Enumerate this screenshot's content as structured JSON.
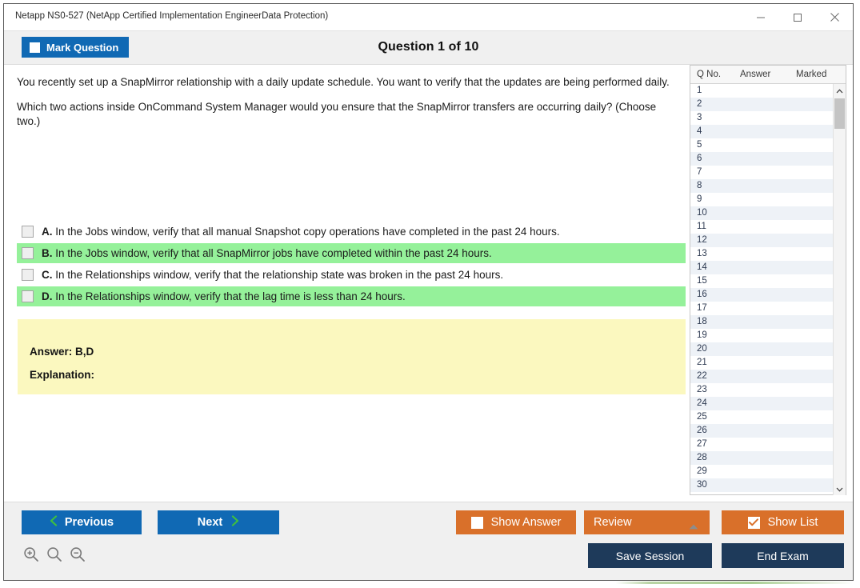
{
  "window": {
    "title": "Netapp NS0-527 (NetApp Certified Implementation EngineerData Protection)",
    "controls": {
      "minimize": "minimize-icon",
      "maximize": "maximize-icon",
      "close": "close-icon"
    }
  },
  "header": {
    "mark_question_label": "Mark Question",
    "question_counter": "Question 1 of 10"
  },
  "question": {
    "stem_paragraphs": [
      "You recently set up a SnapMirror relationship with a daily update schedule. You want to verify that the updates are being performed daily.",
      "Which two actions inside OnCommand System Manager would you ensure that the SnapMirror transfers are occurring daily? (Choose two.)"
    ],
    "options": [
      {
        "letter": "A.",
        "text": "In the Jobs window, verify that all manual Snapshot copy operations have completed in the past 24 hours.",
        "correct": false,
        "checked": false
      },
      {
        "letter": "B.",
        "text": "In the Jobs window, verify that all SnapMirror jobs have completed within the past 24 hours.",
        "correct": true,
        "checked": false
      },
      {
        "letter": "C.",
        "text": "In the Relationships window, verify that the relationship state was broken in the past 24 hours.",
        "correct": false,
        "checked": false
      },
      {
        "letter": "D.",
        "text": "In the Relationships window, verify that the lag time is less than 24 hours.",
        "correct": true,
        "checked": false
      }
    ],
    "answer_label": "Answer: B,D",
    "explanation_label": "Explanation:"
  },
  "list_panel": {
    "columns": [
      "Q No.",
      "Answer",
      "Marked"
    ],
    "rows": [
      {
        "no": "1",
        "answer": "",
        "marked": ""
      },
      {
        "no": "2",
        "answer": "",
        "marked": ""
      },
      {
        "no": "3",
        "answer": "",
        "marked": ""
      },
      {
        "no": "4",
        "answer": "",
        "marked": ""
      },
      {
        "no": "5",
        "answer": "",
        "marked": ""
      },
      {
        "no": "6",
        "answer": "",
        "marked": ""
      },
      {
        "no": "7",
        "answer": "",
        "marked": ""
      },
      {
        "no": "8",
        "answer": "",
        "marked": ""
      },
      {
        "no": "9",
        "answer": "",
        "marked": ""
      },
      {
        "no": "10",
        "answer": "",
        "marked": ""
      },
      {
        "no": "11",
        "answer": "",
        "marked": ""
      },
      {
        "no": "12",
        "answer": "",
        "marked": ""
      },
      {
        "no": "13",
        "answer": "",
        "marked": ""
      },
      {
        "no": "14",
        "answer": "",
        "marked": ""
      },
      {
        "no": "15",
        "answer": "",
        "marked": ""
      },
      {
        "no": "16",
        "answer": "",
        "marked": ""
      },
      {
        "no": "17",
        "answer": "",
        "marked": ""
      },
      {
        "no": "18",
        "answer": "",
        "marked": ""
      },
      {
        "no": "19",
        "answer": "",
        "marked": ""
      },
      {
        "no": "20",
        "answer": "",
        "marked": ""
      },
      {
        "no": "21",
        "answer": "",
        "marked": ""
      },
      {
        "no": "22",
        "answer": "",
        "marked": ""
      },
      {
        "no": "23",
        "answer": "",
        "marked": ""
      },
      {
        "no": "24",
        "answer": "",
        "marked": ""
      },
      {
        "no": "25",
        "answer": "",
        "marked": ""
      },
      {
        "no": "26",
        "answer": "",
        "marked": ""
      },
      {
        "no": "27",
        "answer": "",
        "marked": ""
      },
      {
        "no": "28",
        "answer": "",
        "marked": ""
      },
      {
        "no": "29",
        "answer": "",
        "marked": ""
      },
      {
        "no": "30",
        "answer": "",
        "marked": ""
      }
    ]
  },
  "footer": {
    "previous_label": "Previous",
    "next_label": "Next",
    "show_answer_label": "Show Answer",
    "show_answer_checked": false,
    "review_label": "Review",
    "show_list_label": "Show List",
    "show_list_checked": true,
    "save_session_label": "Save Session",
    "end_exam_label": "End Exam",
    "zoom_icons": [
      "zoom-in-icon",
      "zoom-normal-icon",
      "zoom-out-icon"
    ]
  },
  "colors": {
    "primary_blue": "#1069b4",
    "accent_orange": "#d9702a",
    "navy": "#1e3a5a",
    "correct_green": "#95f19a",
    "answer_yellow": "#fbf8bf",
    "chevron_green": "#3fbf3f"
  }
}
